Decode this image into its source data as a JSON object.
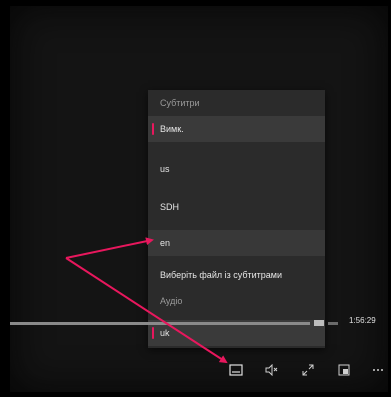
{
  "menu": {
    "subtitles_header": "Субтитри",
    "audio_header": "Аудіо",
    "items": [
      {
        "label": "Вимк.",
        "selected": true
      },
      {
        "label": "us",
        "selected": false
      },
      {
        "label": "SDH",
        "selected": false
      },
      {
        "label": "en",
        "selected": false
      },
      {
        "label": "Виберіть файл із субтитрами",
        "selected": false
      }
    ],
    "audio_items": [
      {
        "label": "uk",
        "selected": true
      }
    ]
  },
  "player": {
    "time_remaining": "1:56:29"
  },
  "controls": [
    {
      "name": "subtitles-icon"
    },
    {
      "name": "volume-icon"
    },
    {
      "name": "fullscreen-icon"
    },
    {
      "name": "mini-player-icon"
    },
    {
      "name": "more-icon"
    }
  ],
  "colors": {
    "accent": "#e8175d",
    "menu_bg": "#2b2b2b",
    "annotation_arrow": "#e8175d"
  }
}
